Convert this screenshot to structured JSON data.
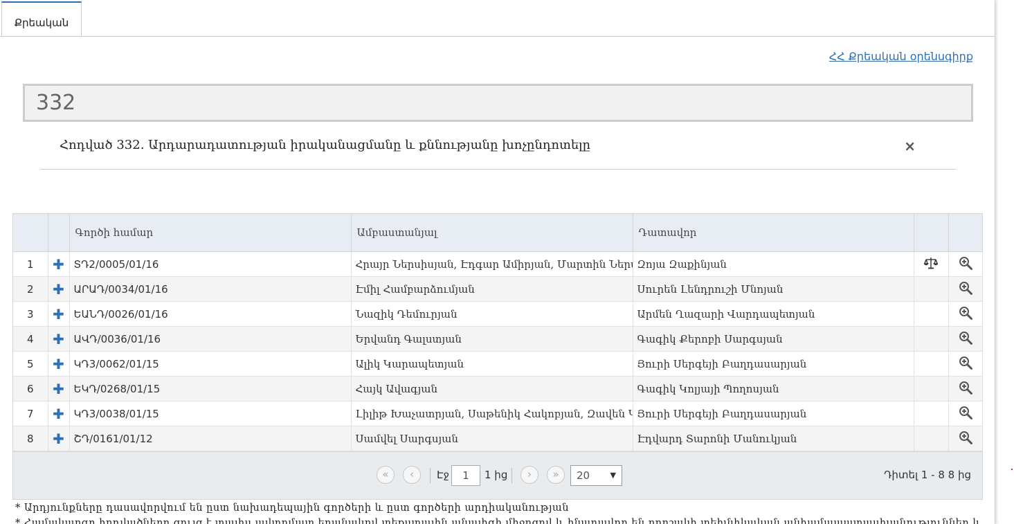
{
  "tabs": [
    {
      "label": "Քրեական"
    }
  ],
  "header": {
    "law_link": "ՀՀ Քրեական օրենսգիրք"
  },
  "search": {
    "value": "332"
  },
  "result": {
    "text": "Հոդված 332. Արդարադատության իրականացմանը և քննությանը խոչընդոտելը",
    "close_icon": "×"
  },
  "table": {
    "columns": [
      "",
      "",
      "Գործի համար",
      "Ամբաստանյալ",
      "Դատավոր",
      "",
      ""
    ],
    "rows": [
      {
        "n": "1",
        "case": "ՏԴ2/0005/01/16",
        "defendant": "Հրայր Ներսիսյան, Էդգար Ամիրյան, Մարտին Ներսիսյան",
        "judge": "Զոյա  Զաքինյան",
        "has_scales": true
      },
      {
        "n": "2",
        "case": "ԱՐԱԴ/0034/01/16",
        "defendant": "Էմիլ Համբարձումյան",
        "judge": "Սուրեն Լենդրուշի Մնոյան",
        "has_scales": false
      },
      {
        "n": "3",
        "case": "ԵԱՆԴ/0026/01/16",
        "defendant": "Նազիկ Դեմուրյան",
        "judge": "Արմեն Ղազարի Վարդապետյան",
        "has_scales": false
      },
      {
        "n": "4",
        "case": "ԱՎԴ/0036/01/16",
        "defendant": "Երվանդ Գալստյան",
        "judge": "Գագիկ Քերոբի Սարգսյան",
        "has_scales": false
      },
      {
        "n": "5",
        "case": "ԿԴ3/0062/01/15",
        "defendant": "Ալիկ Կարապետյան",
        "judge": "Յուրի Սերգեյի Բաղդասարյան",
        "has_scales": false
      },
      {
        "n": "6",
        "case": "ԵԿԴ/0268/01/15",
        "defendant": "Հայկ Ավագյան",
        "judge": "Գագիկ Կոլյայի Պողոսյան",
        "has_scales": false
      },
      {
        "n": "7",
        "case": "ԿԴ3/0038/01/15",
        "defendant": "Լիլիթ Խաչատրյան, Սաթենիկ Հակոբյան, Զավեն Կարապետյան",
        "judge": "Յուրի Սերգեյի Բաղդասարյան",
        "has_scales": false
      },
      {
        "n": "8",
        "case": "ՇԴ/0161/01/12",
        "defendant": "Սամվել Սարգսյան",
        "judge": "Էդվարդ Տարոնի Մանուկյան",
        "has_scales": false
      }
    ]
  },
  "pager": {
    "page_label": "Էջ",
    "page": "1",
    "of_label": "1 ից",
    "page_size": "20",
    "range_text": "Դիտել 1 - 8 8 ից"
  },
  "notes": [
    "* Արդյունքները դասավորվում են ըստ նախադեպային գործերի և ըստ գործերի արդիականության",
    "* Համակարգը հոդվածները ցույց է տալիս ավտոմատ եղանակով տեքստային անալիզի միջոցով և հնարավոր են որոշակի տեխնիկական անհամապատասխանություններ և"
  ]
}
